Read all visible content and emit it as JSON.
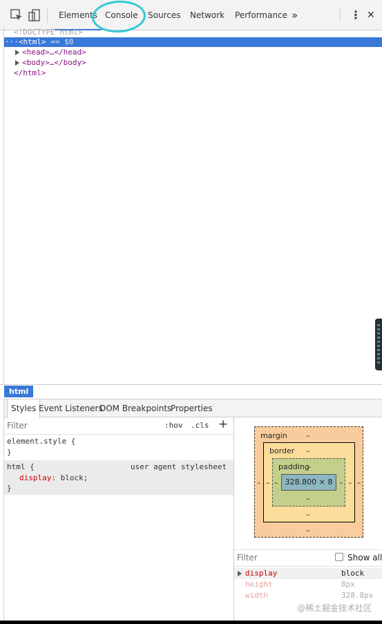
{
  "toolbar": {
    "tabs": [
      {
        "label": "Elements",
        "active": true
      },
      {
        "label": "Console",
        "active": false
      },
      {
        "label": "Sources",
        "active": false
      },
      {
        "label": "Network",
        "active": false
      },
      {
        "label": "Performance",
        "active": false
      }
    ],
    "more_glyph": "»",
    "menu_glyph": "⋮",
    "close_glyph": "✕"
  },
  "dom": {
    "doctype": "<!DOCTYPE html>",
    "selected_prefix": "···",
    "selected_tag": "<html>",
    "selected_suffix": " == $0",
    "head": "<head>…</head>",
    "body": "<body>…</body>",
    "close_html": "</html>"
  },
  "breadcrumb": {
    "item": "html"
  },
  "subtabs": [
    "Styles",
    "Event Listeners",
    "DOM Breakpoints",
    "Properties"
  ],
  "styles": {
    "filter_placeholder": "Filter",
    "hov": ":hov",
    "cls": ".cls",
    "add": "+",
    "element_style_open": "element.style {",
    "element_style_close": "}",
    "rule_selector": "html {",
    "rule_source": "user agent stylesheet",
    "rule_prop": "display",
    "rule_value": " block;",
    "rule_close": "}"
  },
  "box_model": {
    "margin_label": "margin",
    "border_label": "border",
    "padding_label": "padding",
    "dash": "–",
    "content_size": "328.800 × 8"
  },
  "computed": {
    "filter_placeholder": "Filter",
    "show_all": "Show all",
    "rows": [
      {
        "prop": "display",
        "value": "block"
      },
      {
        "prop": "height",
        "value": "8px"
      },
      {
        "prop": "width",
        "value": "328.8px"
      }
    ]
  },
  "watermark": "@稀土掘金技术社区",
  "colors": {
    "accent": "#3879d9",
    "annotation": "#32c8d2",
    "margin": "#f9cc9d",
    "border": "#fddd9b",
    "padding": "#c3d08b",
    "content": "#8cb6c0"
  }
}
